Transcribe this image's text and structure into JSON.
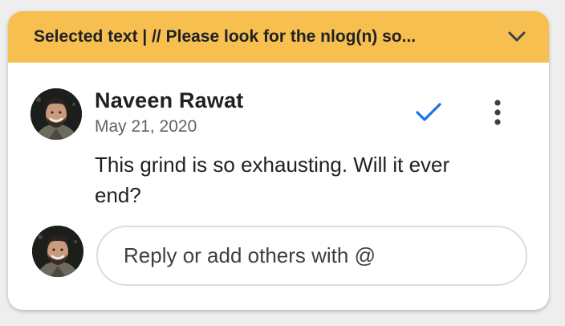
{
  "header": {
    "selected_text": "Selected text | // Please look for the nlog(n) so...",
    "chevron_icon": "chevron-down-icon",
    "background": "#f6bf4f"
  },
  "comment": {
    "author": "Naveen Rawat",
    "date": "May 21, 2020",
    "body": "This grind is so exhausting. Will it ever end?",
    "resolve_icon": "checkmark-icon",
    "more_icon": "more-vert-icon",
    "accent": "#1a73e8"
  },
  "reply": {
    "placeholder": "Reply or add others with @"
  }
}
